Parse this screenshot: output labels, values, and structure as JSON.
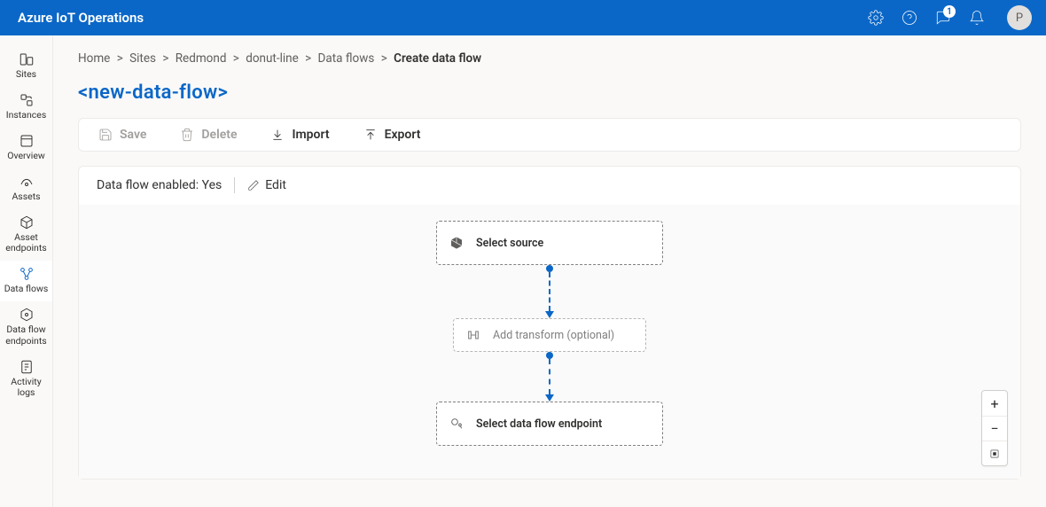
{
  "app": {
    "title": "Azure IoT Operations",
    "user_initial": "P",
    "notification_badge": "1"
  },
  "sidenav": {
    "items": [
      {
        "id": "sites",
        "label": "Sites"
      },
      {
        "id": "instances",
        "label": "Instances"
      },
      {
        "id": "overview",
        "label": "Overview"
      },
      {
        "id": "assets",
        "label": "Assets"
      },
      {
        "id": "asset-endpoints",
        "label": "Asset endpoints"
      },
      {
        "id": "data-flows",
        "label": "Data flows"
      },
      {
        "id": "data-flow-endpoints",
        "label": "Data flow endpoints"
      },
      {
        "id": "activity-logs",
        "label": "Activity logs"
      }
    ],
    "active_id": "data-flows"
  },
  "breadcrumb": [
    {
      "label": "Home"
    },
    {
      "label": "Sites"
    },
    {
      "label": "Redmond"
    },
    {
      "label": "donut-line"
    },
    {
      "label": "Data flows"
    },
    {
      "label": "Create data flow",
      "current": true
    }
  ],
  "page": {
    "title": "<new-data-flow>"
  },
  "toolbar": {
    "save_label": "Save",
    "delete_label": "Delete",
    "import_label": "Import",
    "export_label": "Export"
  },
  "status": {
    "enabled_label": "Data flow enabled: Yes",
    "edit_label": "Edit"
  },
  "flow": {
    "source_label": "Select source",
    "transform_label": "Add transform (optional)",
    "endpoint_label": "Select data flow endpoint"
  },
  "zoom": {
    "in": "+",
    "out": "−"
  }
}
